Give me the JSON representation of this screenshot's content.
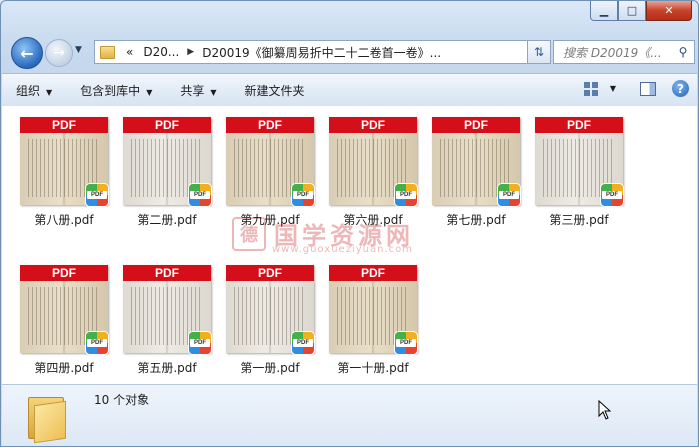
{
  "window": {
    "caption": {
      "minimize": "▁",
      "maximize": "□",
      "close": "✕"
    }
  },
  "nav": {
    "breadcrumbs": [
      "«",
      "D20...",
      "D20019《御纂周易折中二十二卷首一卷》..."
    ],
    "search_placeholder": "搜索 D20019《..."
  },
  "toolbar": {
    "items": [
      {
        "label": "组织",
        "dropdown": true
      },
      {
        "label": "包含到库中",
        "dropdown": true
      },
      {
        "label": "共享",
        "dropdown": true
      },
      {
        "label": "新建文件夹",
        "dropdown": false
      }
    ]
  },
  "files": [
    {
      "name": "第八册.pdf",
      "banner": "PDF"
    },
    {
      "name": "第二册.pdf",
      "banner": "PDF"
    },
    {
      "name": "第九册.pdf",
      "banner": "PDF"
    },
    {
      "name": "第六册.pdf",
      "banner": "PDF"
    },
    {
      "name": "第七册.pdf",
      "banner": "PDF"
    },
    {
      "name": "第三册.pdf",
      "banner": "PDF"
    },
    {
      "name": "第四册.pdf",
      "banner": "PDF"
    },
    {
      "name": "第五册.pdf",
      "banner": "PDF"
    },
    {
      "name": "第一册.pdf",
      "banner": "PDF"
    },
    {
      "name": "第一十册.pdf",
      "banner": "PDF"
    }
  ],
  "watermark": {
    "seal": "德",
    "text": "国学资源网",
    "url": "www.guoxueziyuan.com"
  },
  "status": {
    "count": "10 个对象"
  },
  "colors": {
    "pdf_banner": "#d40f1a",
    "accent": "#2f6fc2"
  },
  "icons": {
    "back": "back-arrow-icon",
    "forward": "forward-arrow-icon",
    "refresh": "refresh-icon",
    "search": "magnifier-icon",
    "help": "help-icon"
  }
}
